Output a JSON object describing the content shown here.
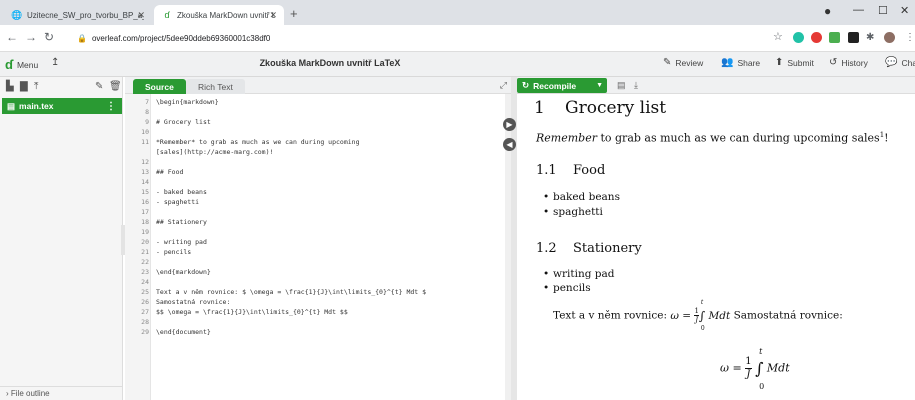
{
  "browser": {
    "tabs": [
      {
        "title": "Uzitecne_SW_pro_tvorbu_BP_a_DP",
        "active": false
      },
      {
        "title": "Zkouška MarkDown uvnitř LaTeX",
        "active": true
      }
    ],
    "url": "overleaf.com/project/5dee90ddeb69360001c38df0"
  },
  "toolbar": {
    "menu_label": "Menu",
    "project_title": "Zkouška MarkDown uvnitř LaTeX",
    "review_label": "Review",
    "share_label": "Share",
    "submit_label": "Submit",
    "history_label": "History",
    "chat_label": "Chat"
  },
  "file_tree": {
    "files": [
      "main.tex"
    ],
    "outline_label": "File outline"
  },
  "editor": {
    "source_tab": "Source",
    "rich_text_tab": "Rich Text",
    "lines": [
      {
        "n": "7",
        "text": "\\begin{markdown}"
      },
      {
        "n": "8",
        "text": ""
      },
      {
        "n": "9",
        "text": "# Grocery list"
      },
      {
        "n": "10",
        "text": ""
      },
      {
        "n": "11",
        "text": "*Remember* to grab as much as we can during upcoming"
      },
      {
        "n": "",
        "text": "[sales](http://acme-marg.com)!"
      },
      {
        "n": "12",
        "text": ""
      },
      {
        "n": "13",
        "text": "## Food"
      },
      {
        "n": "14",
        "text": ""
      },
      {
        "n": "15",
        "text": "- baked beans"
      },
      {
        "n": "16",
        "text": "- spaghetti"
      },
      {
        "n": "17",
        "text": ""
      },
      {
        "n": "18",
        "text": "## Stationery"
      },
      {
        "n": "19",
        "text": ""
      },
      {
        "n": "20",
        "text": "- writing pad"
      },
      {
        "n": "21",
        "text": "- pencils"
      },
      {
        "n": "22",
        "text": ""
      },
      {
        "n": "23",
        "text": "\\end{markdown}"
      },
      {
        "n": "24",
        "text": ""
      },
      {
        "n": "25",
        "text": "Text a v něm rovnice: $ \\omega = \\frac{1}{J}\\int\\limits_{0}^{t} Mdt $"
      },
      {
        "n": "26",
        "text": "Samostatná rovnice:"
      },
      {
        "n": "27",
        "text": "$$ \\omega = \\frac{1}{J}\\int\\limits_{0}^{t} Mdt $$"
      },
      {
        "n": "28",
        "text": ""
      },
      {
        "n": "29",
        "text": "\\end{document}"
      }
    ]
  },
  "pdf": {
    "recompile_label": "Recompile",
    "section_number": "1",
    "section_title": "Grocery list",
    "intro_em": "Remember",
    "intro_rest": " to grab as much as we can during upcoming sales",
    "footnote_mark": "1",
    "intro_end": "!",
    "sub1_number": "1.1",
    "sub1_title": "Food",
    "sub1_items": [
      "baked beans",
      "spaghetti"
    ],
    "sub2_number": "1.2",
    "sub2_title": "Stationery",
    "sub2_items": [
      "writing pad",
      "pencils"
    ],
    "eq_text_before": "Text a v něm rovnice: ",
    "eq_text_after": " Samostatná rovnice:"
  }
}
